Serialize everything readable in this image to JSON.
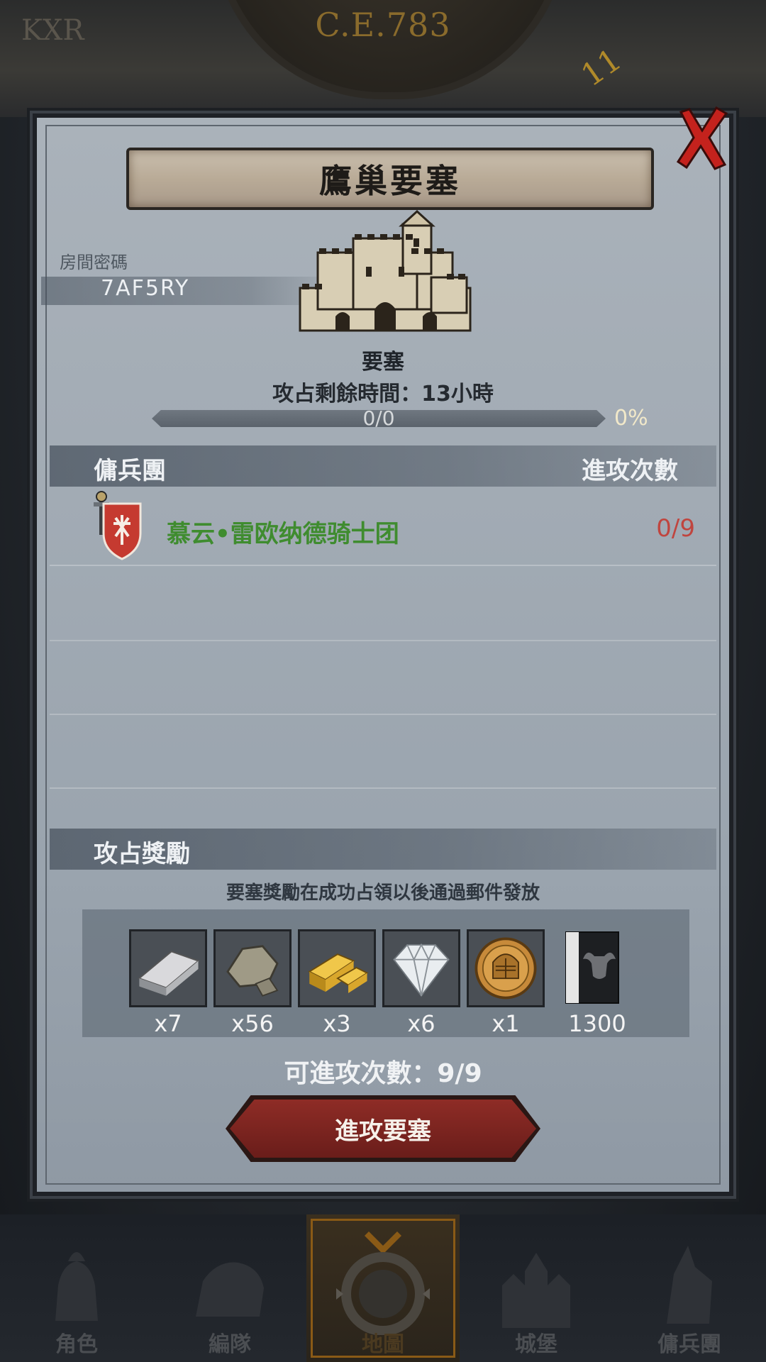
{
  "header": {
    "era": "C.E.783",
    "era_side_number": "11",
    "left_fragment": "KXR"
  },
  "dialog": {
    "title": "鷹巢要塞",
    "room_code_label": "房間密碼",
    "room_code": "7AF5RY",
    "fortress_label": "要塞",
    "time_remaining": "攻占剩餘時間：13小時",
    "progress": {
      "text": "0/0",
      "percent": "0%",
      "fraction": 0
    },
    "mercenary_header": {
      "left": "傭兵團",
      "right": "進攻次數"
    },
    "mercenaries": [
      {
        "name": "慕云•雷欧纳德骑士团",
        "attacks": "0/9",
        "icon": "shield-crest-icon"
      }
    ],
    "rewards_header": "攻占獎勵",
    "rewards_note": "要塞獎勵在成功占領以後通過郵件發放",
    "rewards": [
      {
        "icon": "silver-ingot-icon",
        "count": "x7"
      },
      {
        "icon": "stone-ore-icon",
        "count": "x56"
      },
      {
        "icon": "gold-bars-icon",
        "count": "x3"
      },
      {
        "icon": "diamond-icon",
        "count": "x6"
      },
      {
        "icon": "knight-helmet-coin-icon",
        "count": "x1"
      },
      {
        "icon": "bull-banner-icon",
        "count": "1300"
      }
    ],
    "attack_count": "可進攻次數：9/9",
    "attack_button": "進攻要塞"
  },
  "nav": [
    {
      "label": "角色",
      "icon": "character-icon"
    },
    {
      "label": "編隊",
      "icon": "formation-icon"
    },
    {
      "label": "地圖",
      "icon": "map-icon",
      "active": true
    },
    {
      "label": "城堡",
      "icon": "castle-icon"
    },
    {
      "label": "傭兵團",
      "icon": "mercenary-icon"
    }
  ],
  "colors": {
    "accent_red": "#8e2c26",
    "merc_green": "#3f8c2f",
    "attack_red": "#c0453f",
    "nav_active_gold": "#8a5a16"
  }
}
